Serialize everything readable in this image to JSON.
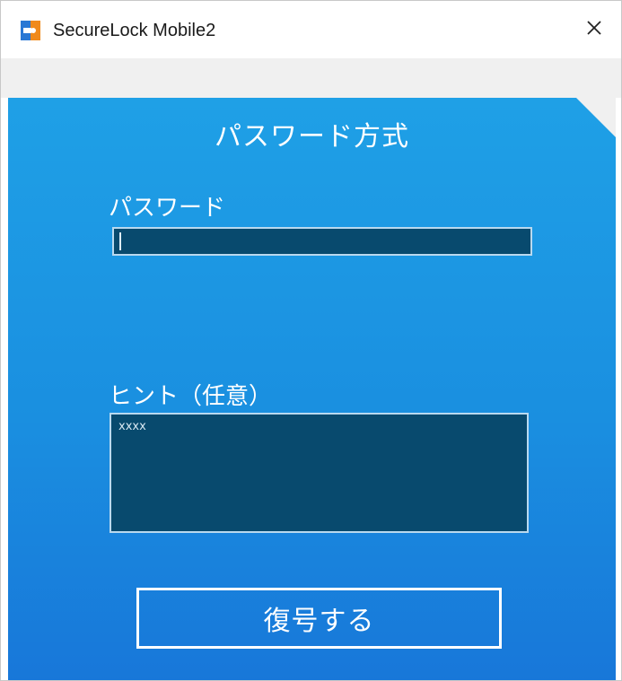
{
  "window": {
    "title": "SecureLock Mobile2",
    "app_icon": "securelock-app-icon",
    "close_icon": "close-icon"
  },
  "panel": {
    "title": "パスワード方式"
  },
  "password": {
    "label": "パスワード",
    "value": ""
  },
  "hint": {
    "label": "ヒント（任意）",
    "value": "xxxx"
  },
  "actions": {
    "decrypt_label": "復号する"
  },
  "colors": {
    "panel_top": "#1fa0e6",
    "panel_bottom": "#1877d9",
    "field_bg": "#084a6e",
    "field_border": "#b9d9ef",
    "strip": "#f0f0f0"
  }
}
